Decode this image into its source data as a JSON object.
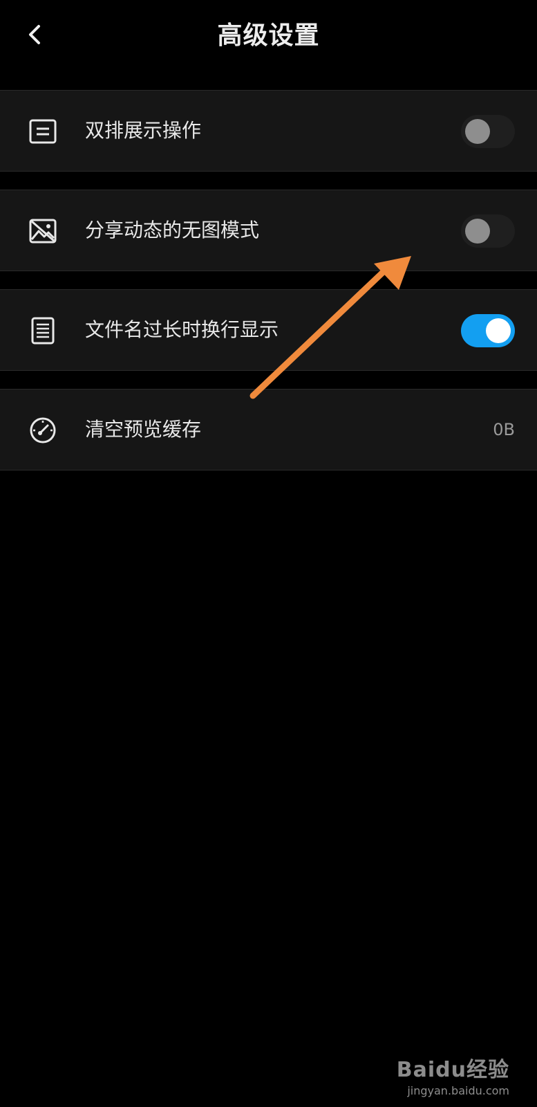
{
  "header": {
    "title": "高级设置"
  },
  "settings": [
    {
      "label": "双排展示操作",
      "icon": "double-row-icon",
      "control": "toggle",
      "enabled": false
    },
    {
      "label": "分享动态的无图模式",
      "icon": "no-image-icon",
      "control": "toggle",
      "enabled": false
    },
    {
      "label": "文件名过长时换行显示",
      "icon": "text-wrap-icon",
      "control": "toggle",
      "enabled": true
    },
    {
      "label": "清空预览缓存",
      "icon": "gauge-icon",
      "control": "value",
      "value": "0B"
    }
  ],
  "colors": {
    "toggle_on": "#139ff1",
    "annotation_arrow": "#f08a3c"
  },
  "watermark": {
    "brand": "Baidu经验",
    "url": "jingyan.baidu.com"
  }
}
